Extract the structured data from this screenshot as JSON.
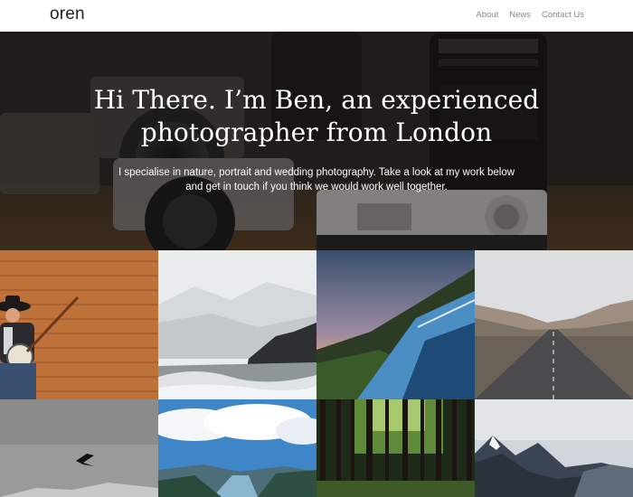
{
  "site": {
    "logo": "oren"
  },
  "nav": {
    "items": [
      {
        "label": "About"
      },
      {
        "label": "News"
      },
      {
        "label": "Contact Us"
      }
    ]
  },
  "hero": {
    "title_line1": "Hi There. I’m Ben, an experienced",
    "title_line2": "photographer from London",
    "subtitle_line1": "I specialise in nature, portrait and wedding photography. Take a look at my work below",
    "subtitle_line2": "and get in touch if you think we would work well together."
  },
  "gallery": {
    "tiles": [
      {
        "subject": "banjo-player"
      },
      {
        "subject": "misty-coast"
      },
      {
        "subject": "sunset-road"
      },
      {
        "subject": "desert-highway"
      },
      {
        "subject": "bird-in-fog"
      },
      {
        "subject": "fjord-valley"
      },
      {
        "subject": "pine-forest"
      },
      {
        "subject": "snowy-mountains"
      }
    ]
  },
  "colors": {
    "header_bg": "#ffffff",
    "logo": "#222222",
    "nav_text": "#888888",
    "hero_text": "#ffffff"
  }
}
